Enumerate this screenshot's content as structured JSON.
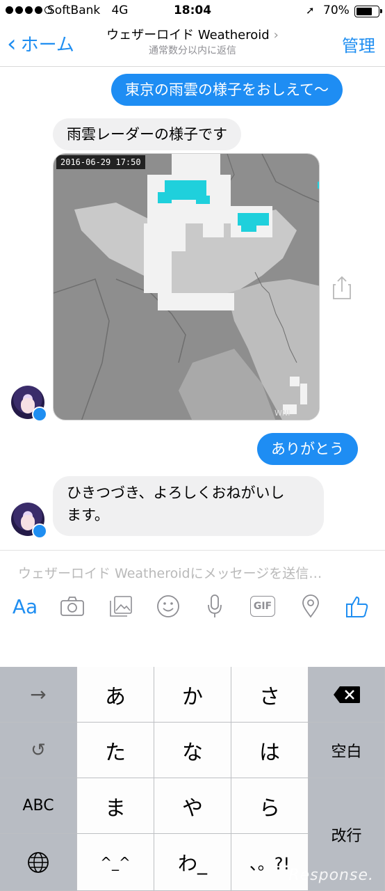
{
  "status_bar": {
    "carrier": "SoftBank",
    "network": "4G",
    "time": "18:04",
    "battery": "70%",
    "signal_bars": 4
  },
  "nav": {
    "back_label": "ホーム",
    "title": "ウェザーロイド Weatheroid",
    "subtitle": "通常数分以内に返信",
    "manage_label": "管理"
  },
  "messages": {
    "user_1": "東京の雨雲の様子をおしえて〜",
    "bot_1": "雨雲レーダーの様子です",
    "radar_timestamp": "2016-06-29 17:50",
    "user_2": "ありがとう",
    "bot_2_line1": "ひきつづき、よろしくおねがいし",
    "bot_2_line2": "ます。"
  },
  "composer": {
    "placeholder": "ウェザーロイド Weatheroidにメッセージを送信…",
    "aa_label": "Aa",
    "gif_label": "GIF"
  },
  "keyboard": {
    "rows": [
      [
        "→",
        "あ",
        "か",
        "さ",
        "⌫"
      ],
      [
        "↺",
        "た",
        "な",
        "は",
        "空白"
      ],
      [
        "ABC",
        "ま",
        "や",
        "ら",
        "改行"
      ],
      [
        "🌐",
        "^_^",
        "わ_",
        "、。?!",
        ""
      ]
    ]
  },
  "watermark": "Response.",
  "colors": {
    "accent": "#1f8ef1",
    "bubble_out": "#1e8df3",
    "bubble_in": "#f0f0f1"
  }
}
